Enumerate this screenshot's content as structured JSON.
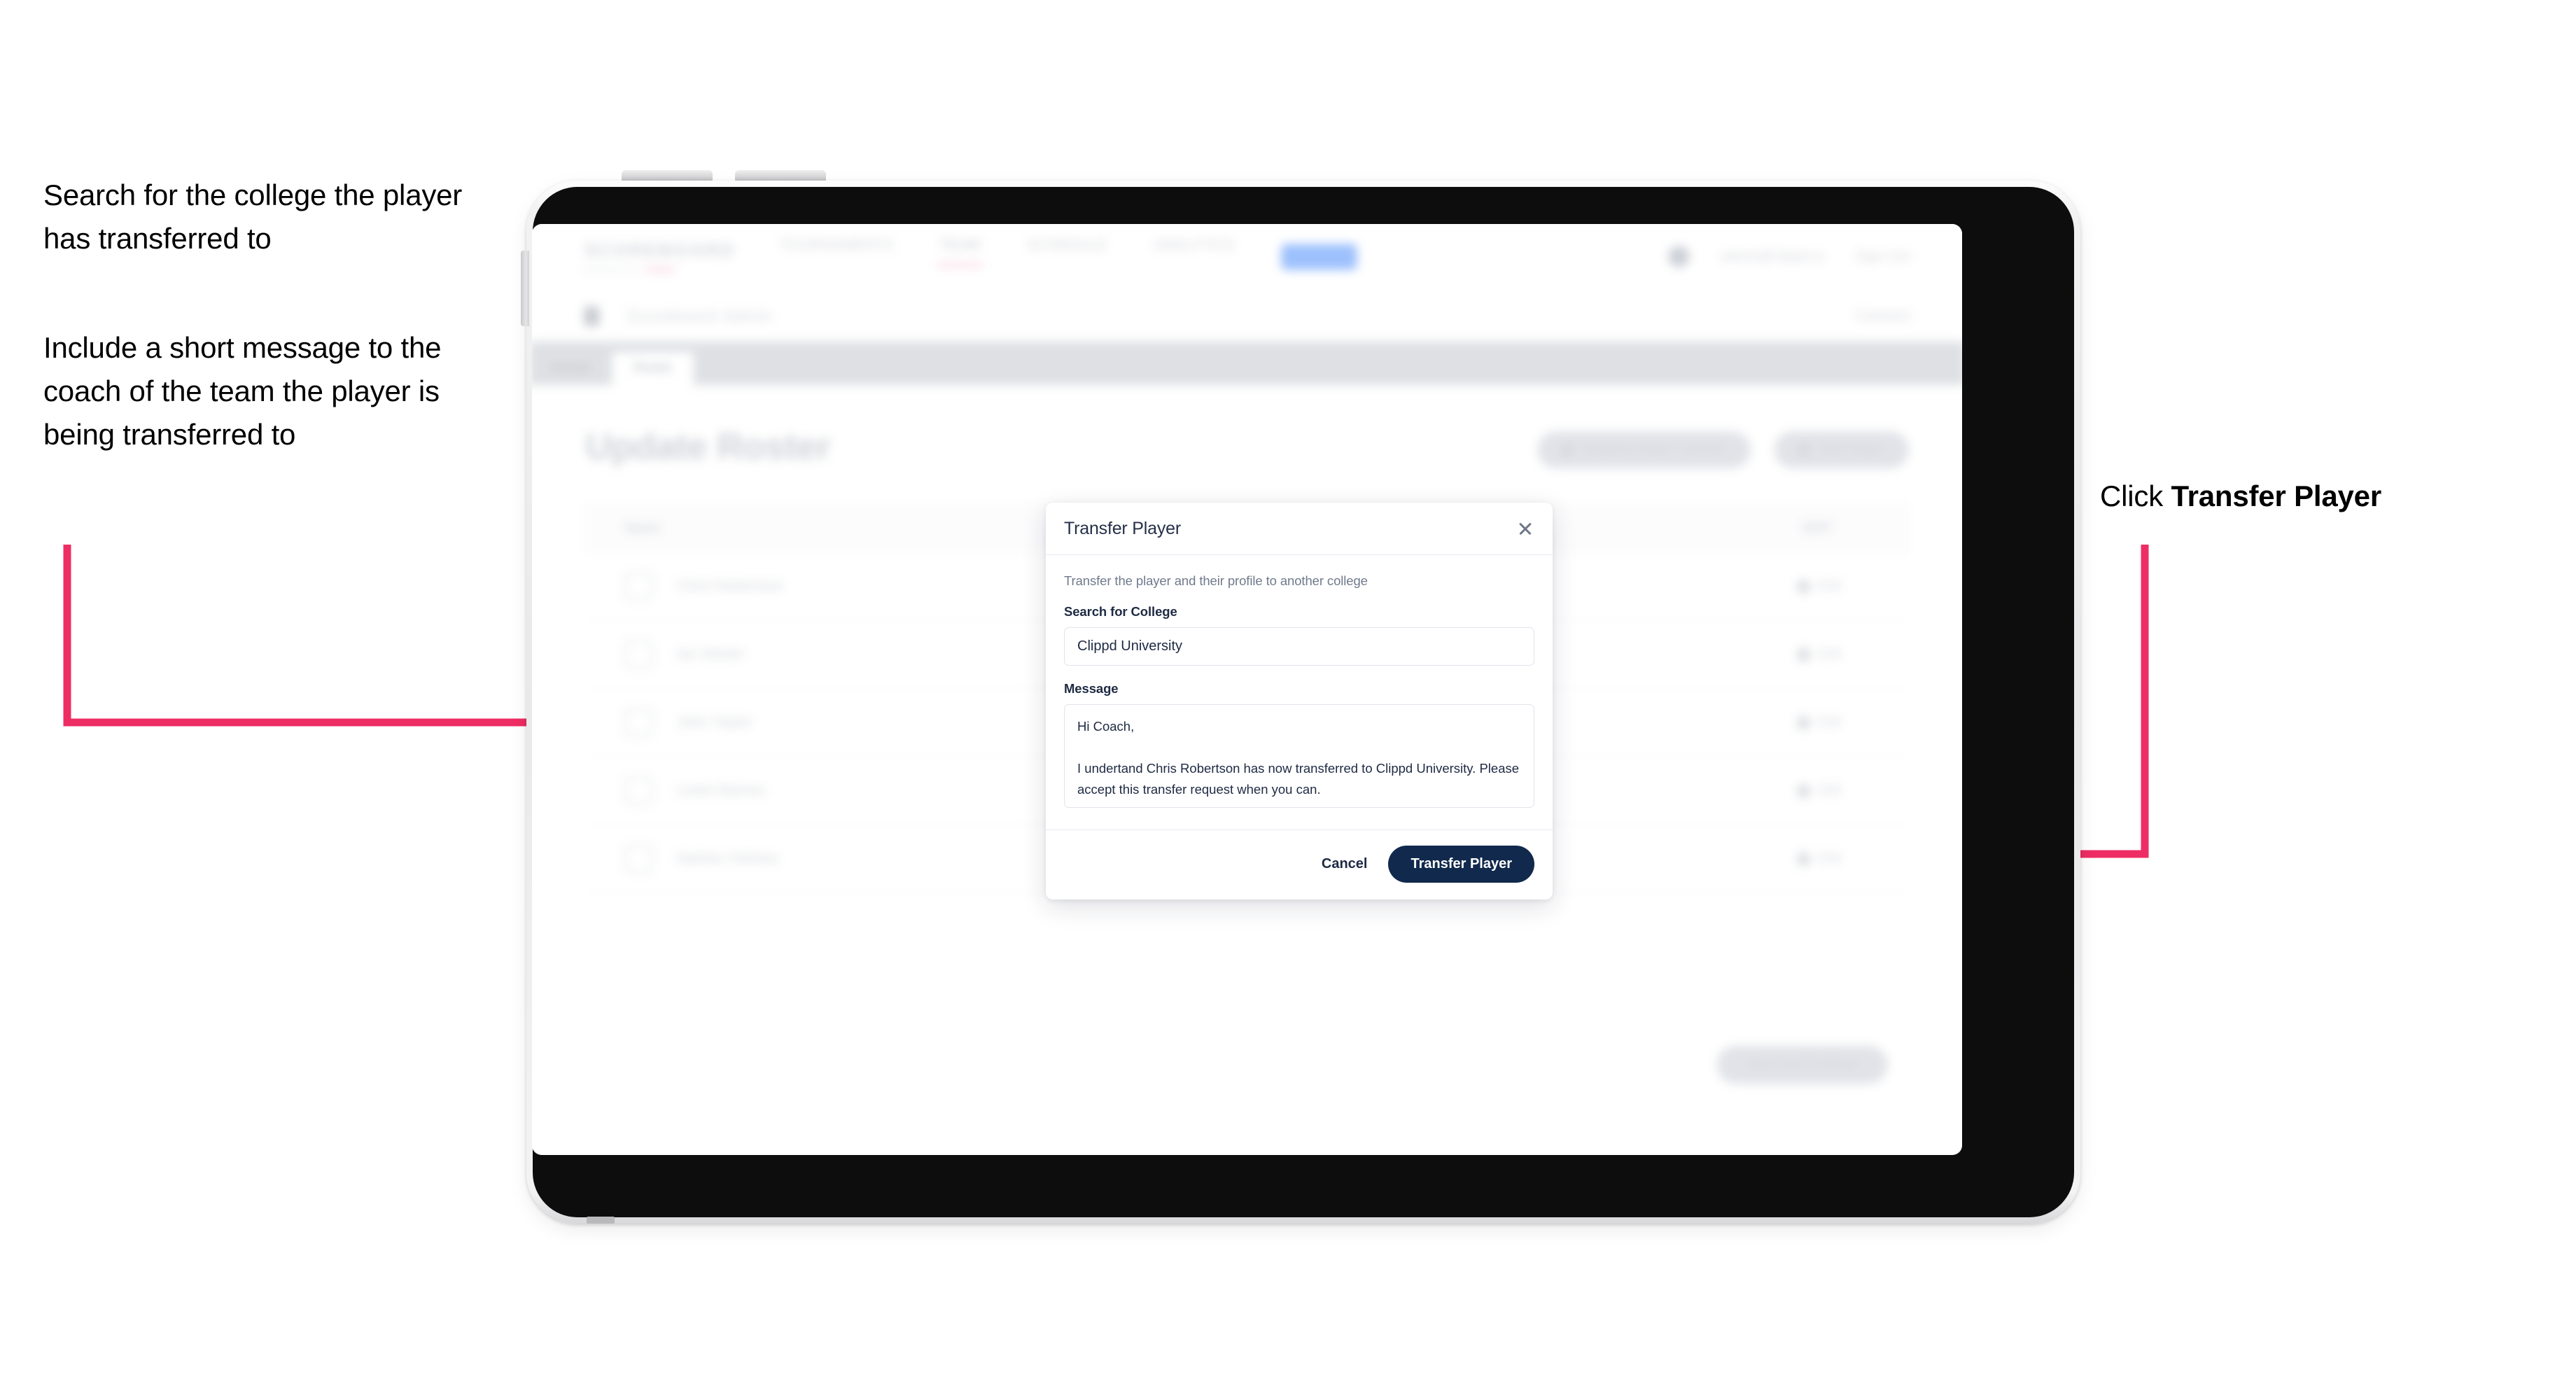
{
  "annotations": {
    "left_1": "Search for the college the player has transferred to",
    "left_2": "Include a short message to the coach of the team the player is being transferred to",
    "right_1_prefix": "Click ",
    "right_1_bold": "Transfer Player"
  },
  "colors": {
    "accent_pink": "#ED2D63",
    "primary_navy": "#10294C",
    "modal_title": "#253047",
    "muted_text": "#707A8C",
    "border": "#DFE3EA"
  },
  "app": {
    "navbar": {
      "logo_main": "SCOREBOARD",
      "logo_sub": "powered by",
      "logo_sub_pink": "clippd",
      "links": [
        {
          "label": "TOURNAMENTS",
          "active": false
        },
        {
          "label": "TEAM",
          "active": true
        },
        {
          "label": "SCHEDULE",
          "active": false
        },
        {
          "label": "ANALYTICS",
          "active": false
        }
      ],
      "pill_label": "ADMIN",
      "account": "admin@clippd.io",
      "signout": "Sign Out"
    },
    "subbar": {
      "title": "Scoreboard",
      "title_sub": "Admin",
      "right_label": "Connect"
    },
    "tabs": [
      {
        "label": "Details",
        "active": false
      },
      {
        "label": "Roster",
        "active": true
      }
    ],
    "page_title": "Update Roster",
    "header_actions": [
      {
        "label": "Request Player Transfer"
      },
      {
        "label": "Add Player"
      }
    ],
    "roster": {
      "columns": [
        "Name",
        "EDIT"
      ],
      "rows": [
        {
          "name": "Chris Robertson",
          "edit": "Edit"
        },
        {
          "name": "Ian Winter",
          "edit": "Edit"
        },
        {
          "name": "John Taylor",
          "edit": "Edit"
        },
        {
          "name": "Lewis Barnes",
          "edit": "Edit"
        },
        {
          "name": "Nathan Holmes",
          "edit": "Edit"
        }
      ]
    },
    "footer_action": "Save And Continue"
  },
  "modal": {
    "title": "Transfer Player",
    "close_icon": "close-icon",
    "description": "Transfer the player and their profile to another college",
    "college_field": {
      "label": "Search for College",
      "value": "Clippd University",
      "placeholder": "Search for College"
    },
    "message_field": {
      "label": "Message",
      "value": "Hi Coach,\n\nI undertand Chris Robertson has now transferred to Clippd University. Please accept this transfer request when you can.",
      "placeholder": "Message"
    },
    "cancel_label": "Cancel",
    "submit_label": "Transfer Player"
  }
}
